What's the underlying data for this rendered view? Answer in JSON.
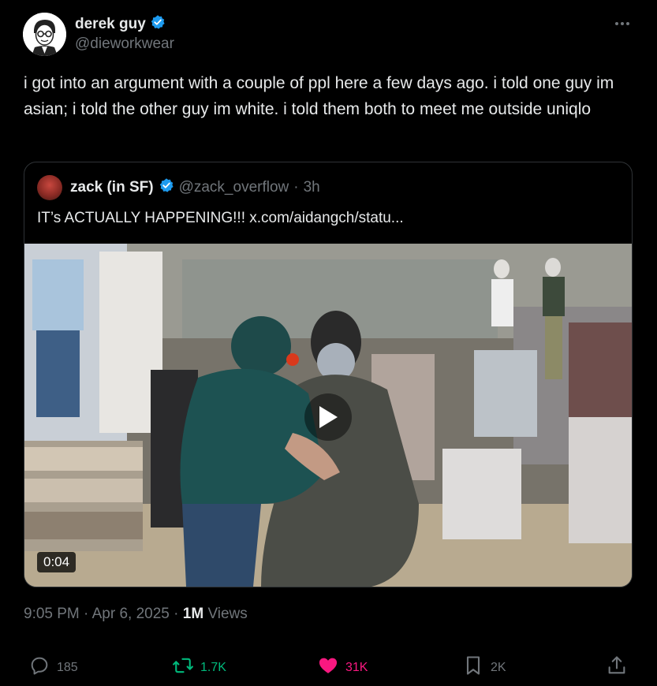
{
  "author": {
    "display_name": "derek guy",
    "handle": "@dieworkwear",
    "verified": true,
    "verified_color": "#1d9bf0"
  },
  "more_icon": "more-horizontal-icon",
  "tweet": {
    "text": "i got into an argument with a couple of ppl here a few days ago. i told one guy im asian; i told the other guy im white. i told them both to meet me outside uniqlo"
  },
  "quote": {
    "display_name": "zack (in SF)",
    "handle": "@zack_overflow",
    "separator": "·",
    "time": "3h",
    "text": "IT’s ACTUALLY HAPPENING!!!  x.com/aidangch/statu...",
    "video": {
      "duration": "0:04",
      "play_icon": "play-icon"
    }
  },
  "meta": {
    "time": "9:05 PM",
    "sep1": "·",
    "date": "Apr 6, 2025",
    "sep2": "·",
    "views_count": "1M",
    "views_label": "Views"
  },
  "actions": {
    "replies": "185",
    "reposts": "1.7K",
    "likes": "31K",
    "bookmarks": "2K"
  },
  "colors": {
    "background": "#000000",
    "text": "#e7e9ea",
    "muted": "#71767b",
    "repost_active": "#00ba7c",
    "like_active": "#f91880",
    "border": "#2f3336"
  }
}
